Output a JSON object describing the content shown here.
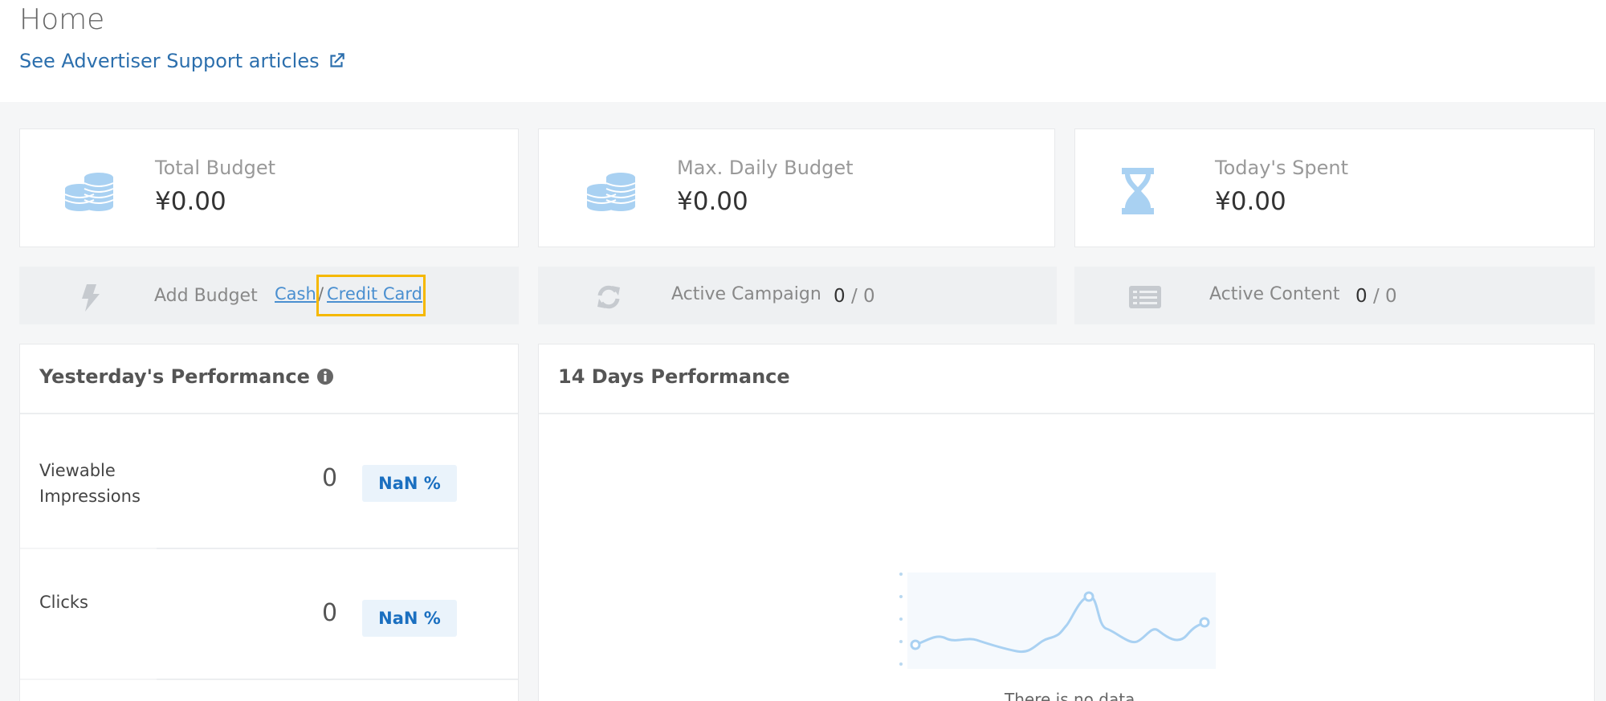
{
  "header": {
    "title": "Home",
    "support_link": "See Advertiser Support articles",
    "external_icon": "external-link-icon"
  },
  "stats": [
    {
      "label": "Total Budget",
      "value": "¥0.00",
      "icon": "coins-icon"
    },
    {
      "label": "Max. Daily Budget",
      "value": "¥0.00",
      "icon": "coins-icon"
    },
    {
      "label": "Today's Spent",
      "value": "¥0.00",
      "icon": "hourglass-icon"
    }
  ],
  "actions": {
    "add_budget": {
      "label": "Add Budget",
      "icon": "bolt-icon",
      "cash": "Cash",
      "separator": "/",
      "credit_card": "Credit Card"
    },
    "active_campaign": {
      "label": "Active Campaign",
      "icon": "refresh-icon",
      "active": "0",
      "total": "0"
    },
    "active_content": {
      "label": "Active Content",
      "icon": "list-icon",
      "active": "0",
      "total": "0"
    }
  },
  "yesterday": {
    "title": "Yesterday's Performance",
    "info_icon": "info-icon",
    "metrics": [
      {
        "label_line1": "Viewable",
        "label_line2": "Impressions",
        "value": "0",
        "change": "NaN %"
      },
      {
        "label_line1": "Clicks",
        "label_line2": "",
        "value": "0",
        "change": "NaN %"
      }
    ]
  },
  "fourteen_days": {
    "title": "14 Days Performance",
    "empty_icon": "empty-chart-icon",
    "empty_text": "There is no data"
  },
  "colors": {
    "link": "#2c6fad",
    "icon_blue": "#a9d1f2",
    "icon_gray": "#c6cacf",
    "badge_bg": "#eaf3fb",
    "badge_text": "#1a6fc0",
    "highlight": "#f5b800"
  }
}
